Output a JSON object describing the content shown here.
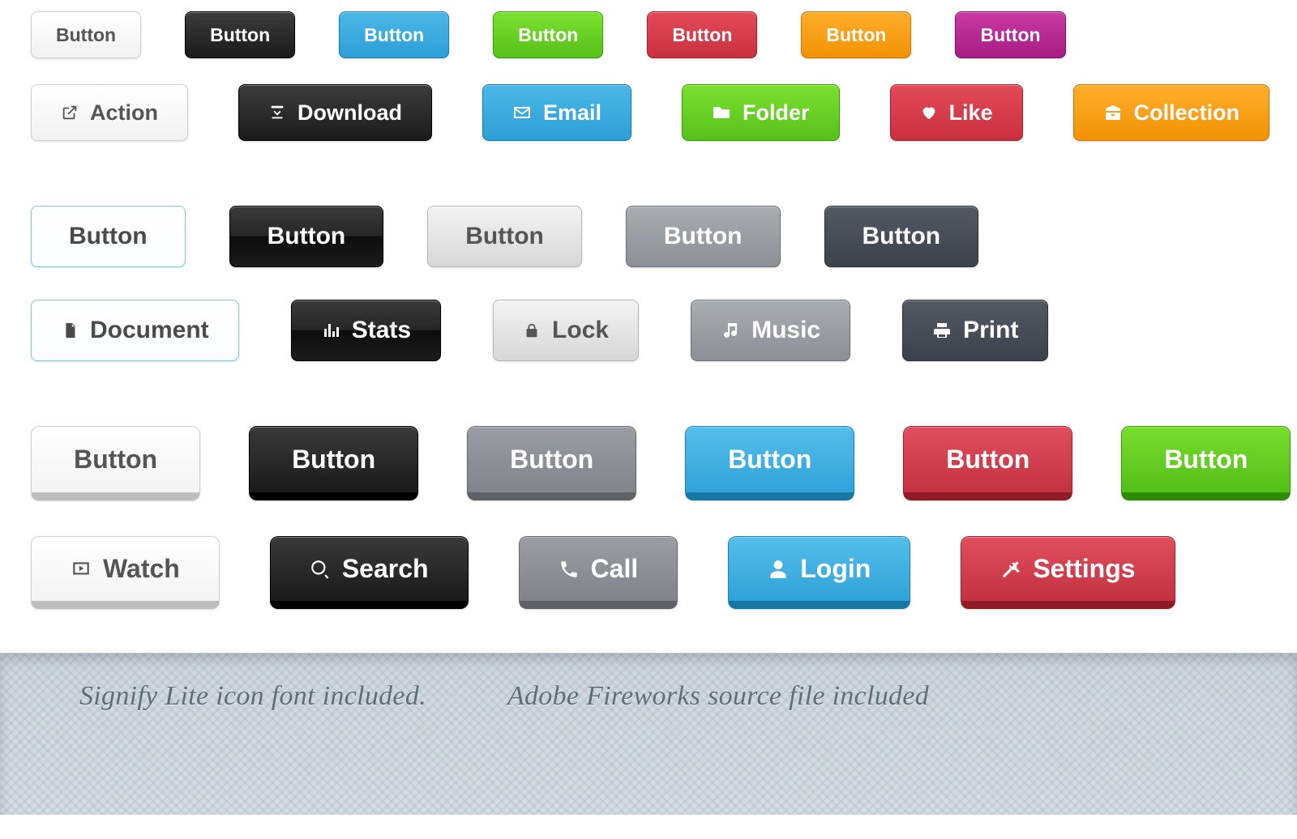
{
  "labels": {
    "button": "Button"
  },
  "row2": {
    "action": {
      "label": "Action"
    },
    "download": {
      "label": "Download"
    },
    "email": {
      "label": "Email"
    },
    "folder": {
      "label": "Folder"
    },
    "like": {
      "label": "Like"
    },
    "collection": {
      "label": "Collection"
    }
  },
  "row4": {
    "document": {
      "label": "Document"
    },
    "stats": {
      "label": "Stats"
    },
    "lock": {
      "label": "Lock"
    },
    "music": {
      "label": "Music"
    },
    "print": {
      "label": "Print"
    }
  },
  "row6": {
    "watch": {
      "label": "Watch"
    },
    "search": {
      "label": "Search"
    },
    "call": {
      "label": "Call"
    },
    "login": {
      "label": "Login"
    },
    "settings": {
      "label": "Settings"
    }
  },
  "footer": {
    "col1": "Signify Lite icon font included.",
    "col2": "Adobe Fireworks source file included"
  },
  "colors": {
    "white": "#f1f1f1",
    "black": "#1b1b1b",
    "blue": "#2d9fd6",
    "green": "#55c11a",
    "red": "#c8303f",
    "orange": "#f29202",
    "magenta": "#a81b85",
    "silver": "#d7d7d7",
    "grey": "#8c8f95",
    "slate": "#3c424b"
  }
}
